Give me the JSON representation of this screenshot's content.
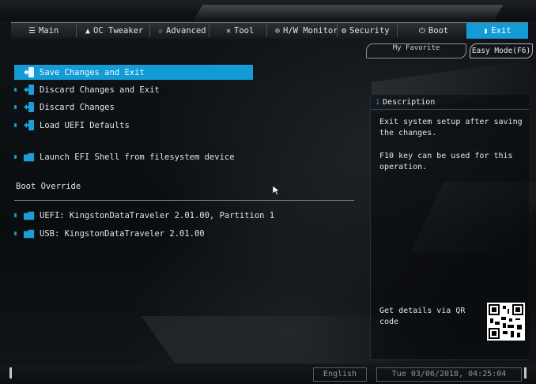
{
  "nav": {
    "tabs": [
      {
        "label": "Main",
        "icon": "list-icon"
      },
      {
        "label": "OC Tweaker",
        "icon": "rocket-icon"
      },
      {
        "label": "Advanced",
        "icon": "star-icon"
      },
      {
        "label": "Tool",
        "icon": "tools-icon"
      },
      {
        "label": "H/W Monitor",
        "icon": "monitor-icon"
      },
      {
        "label": "Security",
        "icon": "shield-icon"
      },
      {
        "label": "Boot",
        "icon": "power-icon"
      },
      {
        "label": "Exit",
        "icon": "exit-icon"
      }
    ],
    "active_tab": "Exit"
  },
  "top_buttons": {
    "favorite": "My Favorite",
    "easy_mode": "Easy Mode(F6)"
  },
  "menu": {
    "items": [
      {
        "label": "Save Changes and Exit",
        "selected": true
      },
      {
        "label": "Discard Changes and Exit"
      },
      {
        "label": "Discard Changes"
      },
      {
        "label": "Load UEFI Defaults"
      },
      {
        "label": "Launch EFI Shell from filesystem device"
      }
    ],
    "boot_override_header": "Boot Override",
    "boot_items": [
      {
        "label": "UEFI: KingstonDataTraveler 2.01.00, Partition 1"
      },
      {
        "label": "USB: KingstonDataTraveler 2.01.00"
      }
    ]
  },
  "description": {
    "title": "Description",
    "text1": "Exit system setup after saving\nthe changes.",
    "text2": "F10 key can be used for this\noperation.",
    "qr_text": "Get details via QR code"
  },
  "status": {
    "language": "English",
    "datetime": "Tue 03/06/2018, 04:25:04"
  },
  "colors": {
    "accent": "#139bd6",
    "background": "#0b0e10",
    "text": "#dfe3e6"
  }
}
